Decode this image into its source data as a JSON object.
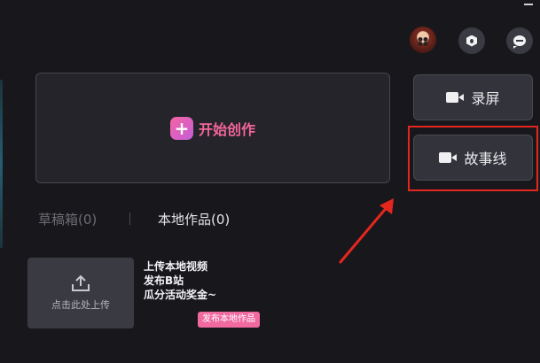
{
  "header": {
    "avatar_icon": "user-avatar",
    "settings_icon": "hexagon-settings-icon",
    "feedback_icon": "chat-bubble-icon"
  },
  "create": {
    "label": "开始创作",
    "icon": "plus-icon",
    "accent": "#f3669a"
  },
  "side_buttons": [
    {
      "label": "录屏",
      "icon": "video-camera-icon"
    },
    {
      "label": "故事线",
      "icon": "video-camera-icon"
    }
  ],
  "highlight_color": "#e5261f",
  "tabs": {
    "draft": "草稿箱(0)",
    "local": "本地作品(0)"
  },
  "upload": {
    "label": "点击此处上传",
    "icon": "upload-icon"
  },
  "promo": {
    "lines": [
      "上传本地视频",
      "发布B站",
      "瓜分活动奖金~"
    ],
    "tag": "发布本地作品",
    "tag_color": "#f06aa0"
  }
}
